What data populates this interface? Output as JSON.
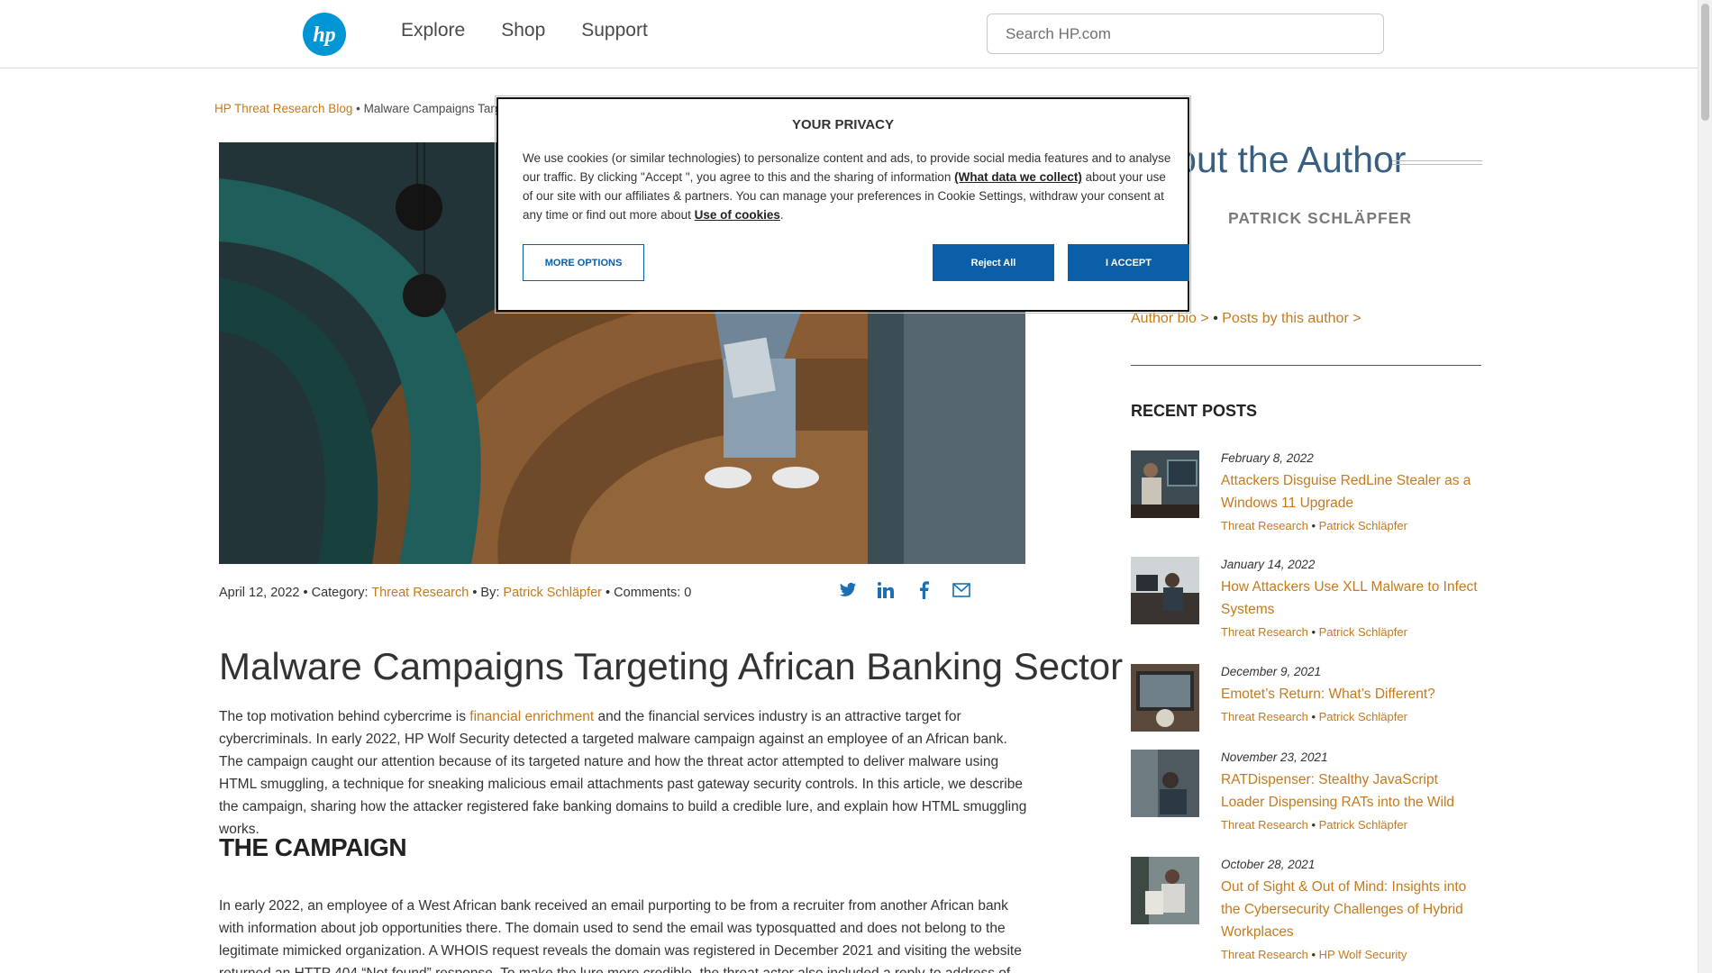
{
  "header": {
    "nav": [
      "Explore",
      "Shop",
      "Support"
    ],
    "search_placeholder": "Search HP.com"
  },
  "breadcrumb": {
    "root": "HP Threat Research Blog",
    "separator": "•",
    "current": "Malware Campaigns Targeting African Banking Sector"
  },
  "article": {
    "meta": {
      "date": "April 12, 2022",
      "category_label": "• Category:",
      "category": "Threat Research",
      "by_label": "• By:",
      "author": "Patrick Schläpfer",
      "comments": "• Comments: 0"
    },
    "share_icons": [
      "twitter-icon",
      "linkedin-icon",
      "facebook-icon",
      "email-icon"
    ],
    "title": "Malware Campaigns Targeting African Banking Sector",
    "para1_before": "The top motivation behind cybercrime is ",
    "para1_link": "financial enrichment",
    "para1_after": " and the financial services industry is an attractive target for cybercriminals. In early 2022, HP Wolf Security detected a targeted malware campaign against an employee of an African bank. The campaign caught our attention because of its targeted nature and how the threat actor attempted to deliver malware using HTML smuggling, a technique for sneaking malicious email attachments past gateway security controls. In this article, we describe the campaign, sharing how the attacker registered fake banking domains to build a credible lure, and explain how HTML smuggling works.",
    "section_heading": "THE CAMPAIGN",
    "para2": "In early 2022, an employee of a West African bank received an email purporting to be from a recruiter from another African bank with information about job opportunities there. The domain used to send the email was typosquatted and does not belong to the legitimate mimicked organization. A WHOIS request reveals the domain was registered in December 2021 and visiting the website returned an HTTP 404 “Not found” response. To make the lure more credible, the threat actor also included a reply-to address of another supposed"
  },
  "sidebar": {
    "about_heading": "About the Author",
    "author_name": "PATRICK SCHLÄPFER",
    "author_bio": "Author bio >",
    "author_sep": "•",
    "author_posts": "Posts by this author >",
    "recent_heading": "RECENT POSTS",
    "posts": [
      {
        "date": "February 8, 2022",
        "title": "Attackers Disguise RedLine Stealer as a Windows 11 Upgrade",
        "tag1": "Threat Research",
        "sep": "•",
        "tag2": "Patrick Schläpfer"
      },
      {
        "date": "January 14, 2022",
        "title": "How Attackers Use XLL Malware to Infect Systems",
        "tag1": "Threat Research",
        "sep": "•",
        "tag2": "Patrick Schläpfer"
      },
      {
        "date": "December 9, 2021",
        "title": "Emotet’s Return: What’s Different?",
        "tag1": "Threat Research",
        "sep": "•",
        "tag2": "Patrick Schläpfer"
      },
      {
        "date": "November 23, 2021",
        "title": "RATDispenser: Stealthy JavaScript Loader Dispensing RATs into the Wild",
        "tag1": "Threat Research",
        "sep": "•",
        "tag2": "Patrick Schläpfer"
      },
      {
        "date": "October 28, 2021",
        "title": "Out of Sight & Out of Mind: Insights into the Cybersecurity Challenges of Hybrid Workplaces",
        "tag1": "Threat Research",
        "sep": "•",
        "tag2": "HP Wolf Security"
      }
    ]
  },
  "cookie_modal": {
    "title": "YOUR PRIVACY",
    "text_1": "We use cookies (or similar technologies) to personalize content and ads, to provide social media features and to analyse our traffic. By clicking \"Accept \", you agree to this and the sharing of information ",
    "link_what": "(What data we collect)",
    "text_2": " about your use of our site with our affiliates & partners. You can manage your preferences in Cookie Settings, withdraw your consent at any time or find out more about ",
    "link_cookies": "Use of cookies",
    "text_3": ".",
    "btn_more": "MORE OPTIONS",
    "btn_reject": "Reject All",
    "btn_accept": "I ACCEPT"
  },
  "colors": {
    "hp_blue": "#0096d6",
    "link_orange": "#c47a1d",
    "button_blue": "#0b5ea8",
    "heading_blue": "#385e82"
  }
}
